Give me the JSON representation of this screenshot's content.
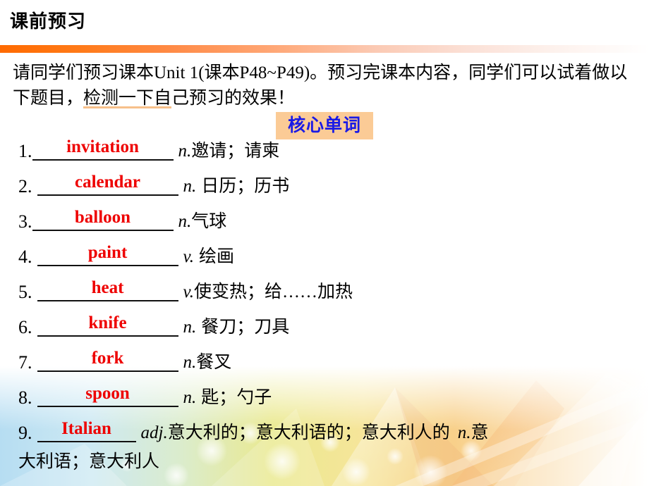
{
  "header": {
    "title": "课前预习",
    "rule_gradient_start": "#ff6a00",
    "rule_gradient_end": "#ffffff"
  },
  "intro": {
    "line1_a": "请同学们预习课本Unit 1(课本P48~P49)。预习完课本内容，同学",
    "line2_a": "们可以试着做以下题目，",
    "line2_highlight": "检测一下自",
    "line2_b": "己预习的效果！",
    "highlight_color": "#f7c08a"
  },
  "section": {
    "chip_label": "核心单词",
    "chip_bg": "#fbcb96",
    "chip_text_color": "#1a1ae6"
  },
  "answer_color": "#ee0000",
  "words": [
    {
      "num": "1.",
      "answer": "invitation",
      "pos": "n.",
      "meaning": "邀请；请柬",
      "blank_width": 200,
      "lead_gap": 0
    },
    {
      "num": "2.",
      "answer": "calendar",
      "pos": "n.",
      "meaning": "日历；历书",
      "blank_width": 200,
      "lead_gap": 7
    },
    {
      "num": "3.",
      "answer": "balloon",
      "pos": "n.",
      "meaning": "气球",
      "blank_width": 200,
      "lead_gap": 0
    },
    {
      "num": "4.",
      "answer": "paint",
      "pos": "v.",
      "meaning": "绘画",
      "blank_width": 200,
      "lead_gap": 7
    },
    {
      "num": "5.",
      "answer": "heat",
      "pos": "v.",
      "meaning": "使变热；给……加热",
      "blank_width": 200,
      "lead_gap": 7
    },
    {
      "num": "6.",
      "answer": "knife",
      "pos": "n.",
      "meaning": "餐刀；刀具",
      "blank_width": 200,
      "lead_gap": 7
    },
    {
      "num": "7.",
      "answer": "fork",
      "pos": "n.",
      "meaning": "餐叉",
      "blank_width": 200,
      "lead_gap": 7
    },
    {
      "num": "8.",
      "answer": "spoon",
      "pos": "n.",
      "meaning": "匙；勺子",
      "blank_width": 200,
      "lead_gap": 7
    },
    {
      "num": "9.",
      "answer": "Italian",
      "pos": "adj.",
      "meaning": "意大利的；意大利语的；意大利人的",
      "pos2": "n.",
      "meaning2": "意",
      "blank_width": 140,
      "lead_gap": 7
    }
  ],
  "wrap_line": "大利语；意大利人"
}
